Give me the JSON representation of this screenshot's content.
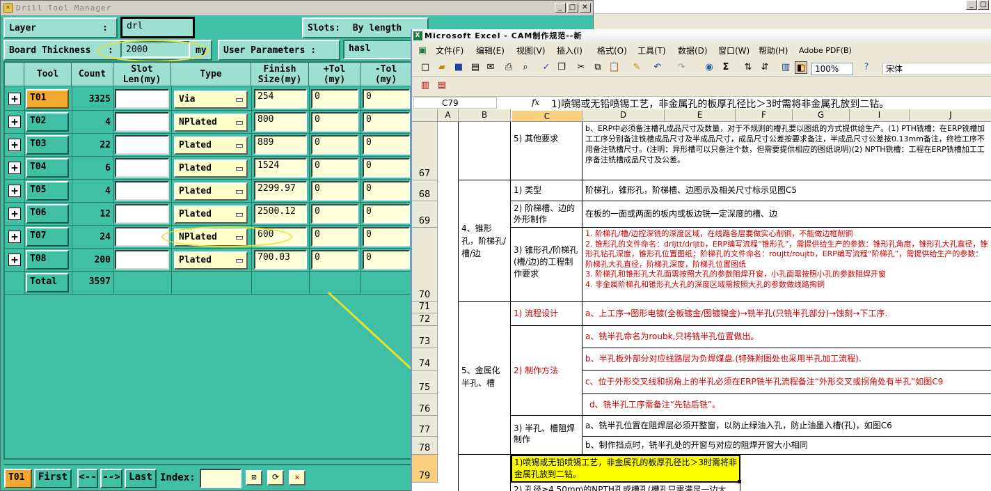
{
  "dtm": {
    "title": "Drill Tool Manager",
    "title_icon": "✕",
    "win_controls": [
      "_",
      "□",
      "✕"
    ],
    "layer_label": "Layer",
    "layer_colon": ":",
    "layer_value": "drl",
    "slots_label": "Slots:",
    "slots_value": "By length",
    "board_label": "Board Thickness",
    "board_colon": ":",
    "board_value": "2000",
    "board_unit": "my",
    "user_params_label": "User Parameters :",
    "user_params_value": "hasl",
    "headers": [
      "Tool",
      "Count",
      "Slot\nLen(my)",
      "Type",
      "Finish\nSize(my)",
      "+Tol\n(my)",
      "-Tol\n(my)"
    ],
    "rows": [
      {
        "tool": "T01",
        "count": "3325",
        "type": "Via",
        "finish": "254",
        "ptol": "0",
        "mtol": "0",
        "active": true
      },
      {
        "tool": "T02",
        "count": "4",
        "type": "NPlated",
        "finish": "800",
        "ptol": "0",
        "mtol": "0",
        "active": false
      },
      {
        "tool": "T03",
        "count": "22",
        "type": "Plated",
        "finish": "889",
        "ptol": "0",
        "mtol": "0",
        "active": false
      },
      {
        "tool": "T04",
        "count": "6",
        "type": "Plated",
        "finish": "1524",
        "ptol": "0",
        "mtol": "0",
        "active": false
      },
      {
        "tool": "T05",
        "count": "4",
        "type": "Plated",
        "finish": "2299.97",
        "ptol": "0",
        "mtol": "0",
        "active": false
      },
      {
        "tool": "T06",
        "count": "12",
        "type": "Plated",
        "finish": "2500.12",
        "ptol": "0",
        "mtol": "0",
        "active": false
      },
      {
        "tool": "T07",
        "count": "24",
        "type": "NPlated",
        "finish": "600",
        "ptol": "0",
        "mtol": "0",
        "active": false
      },
      {
        "tool": "T08",
        "count": "200",
        "type": "Plated",
        "finish": "700.03",
        "ptol": "0",
        "mtol": "0",
        "active": false
      }
    ],
    "total_label": "Total",
    "total_count": "3597",
    "nav": {
      "current": "T01",
      "first": "First",
      "prev": "<--",
      "next": "-->",
      "last": "Last",
      "index_label": "Index:"
    },
    "highlight_color": "#e8e030",
    "accent": "#3fbfa4",
    "button_orange": "#f0a830"
  },
  "excel": {
    "title": "Microsoft Excel - CAM制作规范--新",
    "menus": [
      "文件(F)",
      "编辑(E)",
      "视图(V)",
      "插入(I)",
      "格式(O)",
      "工具(T)",
      "数据(D)",
      "窗口(W)",
      "帮助(H)",
      "Adobe PDF(B)"
    ],
    "zoom": "100%",
    "font": "宋体",
    "name_box": "C79",
    "fx": "fx",
    "formula": "1)喷锡或无铅喷锡工艺，非金属孔的板厚孔径比＞3时需将非金属孔放到二钻。",
    "columns": [
      "A",
      "B",
      "C",
      "D",
      "E",
      "F",
      "G",
      "I",
      "J"
    ],
    "rows": [
      "67",
      "68",
      "69",
      "70",
      "71",
      "72",
      "73",
      "74",
      "75",
      "76",
      "77",
      "78",
      "79"
    ],
    "cells": {
      "c67": "5) 其他要求",
      "d67": "b、ERP中必须备注槽孔成品尺寸及数量，对于不规则的槽孔要以图纸的方式提供给生产。(1) PTH铣槽：在ERP铣槽加工工序分别备注铣槽成品尺寸及半成品尺寸，成品尺寸公差按要求备注，半成品尺寸公差按0.13mm备注，终检工序不用备注铣槽尺寸。(注明：异形槽可以只备注个数，但需要提供相应的图纸说明)(2) NPTH铣槽：工程在ERP铣槽加工工序备注铣槽成品尺寸及公差。",
      "b68": "4、锥形孔，阶梯孔/槽/边",
      "c68": "1) 类型",
      "d68": "阶梯孔，锥形孔，阶梯槽、边图示及相关尺寸标示见图C5",
      "c69": "2) 阶梯槽、边的外形制作",
      "d69": "在板的一面或两面的板内或板边铣一定深度的槽、边",
      "c70": "3) 锥形孔/阶梯孔(槽/边)的工程制作要求",
      "d70_1": "1. 阶梯孔/槽/边控深铣的深度区域，在线路各层要做实心削铜，不能做边框削铜",
      "d70_2": "2. 锥形孔的文件命名：drljtt/drljtb，ERP编写流程“锥形孔”，需提供给生产的参数：锥形孔角度，锥形孔大孔直径，锥形孔钻孔深度，锥形孔位置图纸；阶梯孔的文件命名：roujtt/roujtb，ERP编写流程“阶梯孔”，需提供给生产的参数：阶梯孔大孔直径，阶梯孔深度，阶梯孔位置图纸",
      "d70_3": "3. 阶梯孔和锥形孔大孔面需按照大孔的参数阻焊开窗，小孔面需按照小孔的参数阻焊开窗",
      "d70_4": "4. 非金属阶梯孔和锥形孔大孔的深度区域需按照大孔的参数做线路掏铜",
      "b71": "5、金属化半孔、槽",
      "c71": "1) 流程设计",
      "d71": "a、上工序→图形电镀(全板镀金/图镀镍金)→铣半孔(只铣半孔部分)→蚀刻→下工序.",
      "c73": "2) 制作方法",
      "d73": "a、铣半孔命名为roubk,只将铣半孔位置做出。",
      "d74": "b、半孔板外部分对应线路层为负焊煤盘.(特殊附图处也采用半孔加工流程).",
      "d75": "c、位于外形交叉线和拐角上的半孔必须在ERP铣半孔流程备注“外形交叉或拐角处有半孔”如图C9",
      "d76": "d、铣半孔工序需备注“先钻后铣”。",
      "c77": "3) 半孔、槽阻焊制作",
      "d77": "a、铣半孔位置在阻焊层必须开整窗，以防止绿油入孔，防止油墨入槽(孔)，如图C6",
      "d78": "b、制作挡点时，铣半孔处的开窗与对应的阻焊开窗大小相同",
      "c79": "1)喷锡或无铅喷锡工艺，非金属孔的板厚孔径比＞3时需将非金属孔放到二钻。",
      "c80": "2) 孔径≥4.50mm的NPTH孔或槽孔(槽孔只需满足一边大"
    }
  },
  "back_window_controls": [
    "_",
    "□"
  ]
}
